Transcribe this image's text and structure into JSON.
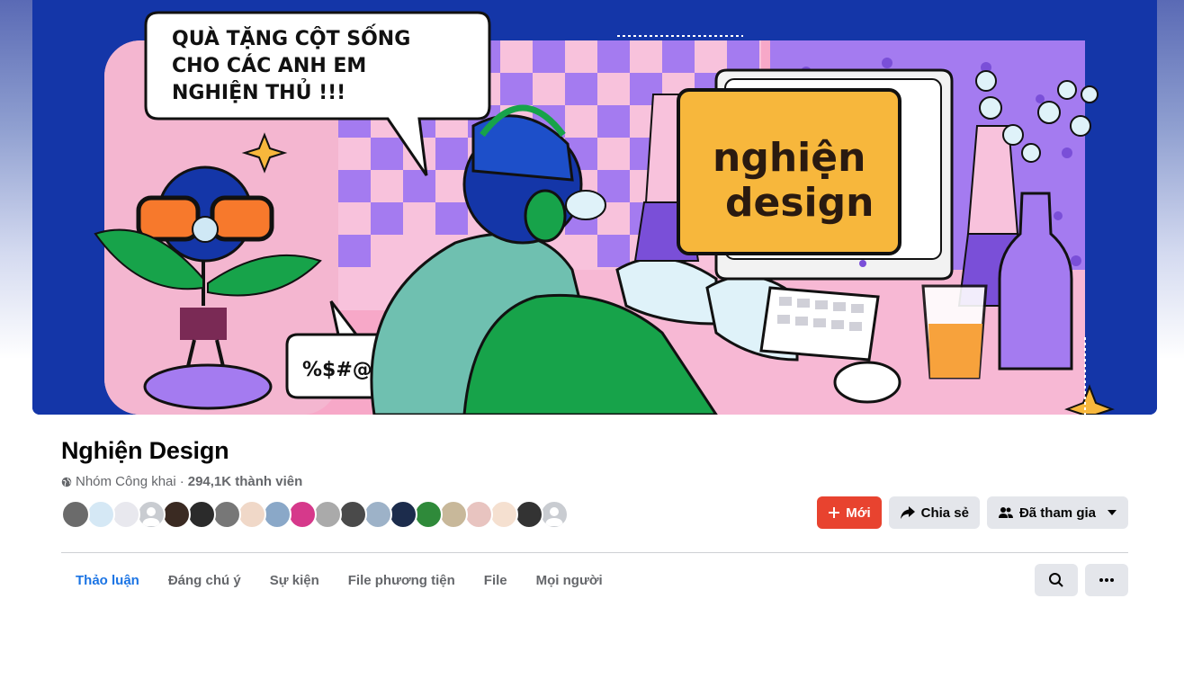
{
  "cover": {
    "speech_bubble_text": [
      "QUÀ TẶNG CỘT SỐNG",
      "CHO CÁC ANH EM",
      "NGHIỆN THỦ !!!"
    ],
    "curse_bubble_text": "%$#@",
    "monitor_logo_lines": [
      "nghiện",
      "design"
    ],
    "colors": {
      "background": "#1436a8",
      "pink": "#f7a8c8",
      "purple": "#a47bf0",
      "orange": "#f7b73c",
      "green": "#17a34a",
      "teal": "#6fc0b0"
    }
  },
  "group": {
    "name": "Nghiện Design",
    "privacy": "Nhóm Công khai",
    "separator": "·",
    "members": "294,1K thành viên",
    "privacy_icon": "globe-icon"
  },
  "member_avatars": [
    "#6b6b6b",
    "#d5e8f5",
    "#e8e8ee",
    "#c9ccd1",
    "#3a2a22",
    "#2b2b2b",
    "#777777",
    "#f0d8c8",
    "#8aa8c8",
    "#d6398b",
    "#aaaaaa",
    "#4a4a4a",
    "#9db2c8",
    "#1c2c4c",
    "#2f8a3a",
    "#c8b89a",
    "#e8c4c0",
    "#f5e0d0",
    "#333333",
    "#c9ccd1"
  ],
  "actions": {
    "new_label": "Mới",
    "share_label": "Chia sẻ",
    "joined_label": "Đã tham gia"
  },
  "tabs": [
    {
      "label": "Thảo luận"
    },
    {
      "label": "Đáng chú ý"
    },
    {
      "label": "Sự kiện"
    },
    {
      "label": "File phương tiện"
    },
    {
      "label": "File"
    },
    {
      "label": "Mọi người"
    }
  ],
  "colors": {
    "accent_blue": "#1b74e4",
    "primary_button": "#e8432f",
    "secondary_button": "#e4e6eb"
  }
}
